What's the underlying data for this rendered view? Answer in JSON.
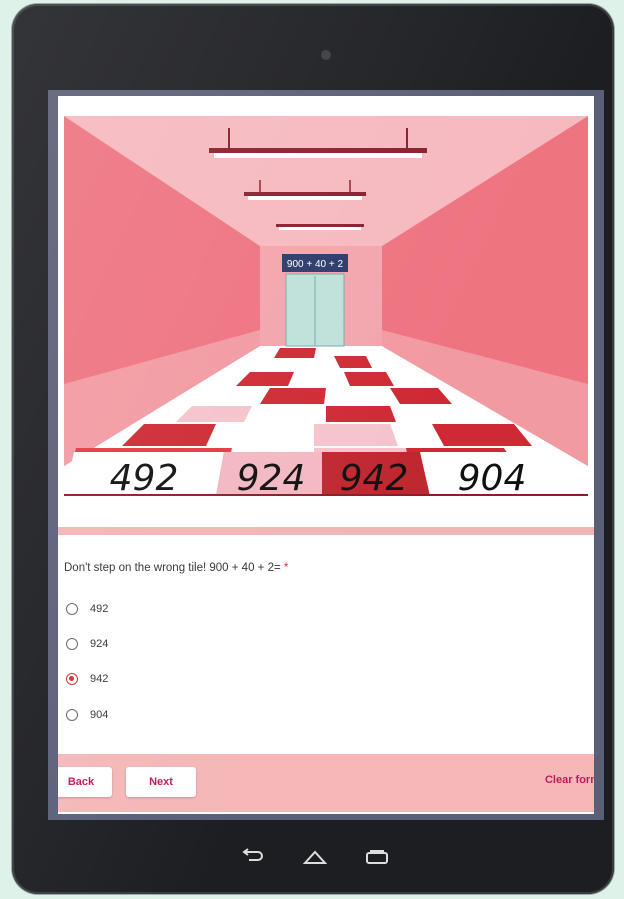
{
  "hero": {
    "elevator_sign": "900 + 40 + 2",
    "tiles": [
      "492",
      "924",
      "942",
      "904"
    ]
  },
  "question": {
    "text": "Don't step on the wrong tile! 900 + 40 + 2=",
    "required_mark": "*"
  },
  "options": [
    "492",
    "924",
    "942",
    "904"
  ],
  "selected_option": "942",
  "nav": {
    "back_label": "Back",
    "next_label": "Next",
    "clear_label": "Clear form"
  },
  "system_nav": {
    "icons": [
      "back-icon",
      "home-icon",
      "recents-icon"
    ]
  },
  "colors": {
    "accent": "#d93025",
    "link": "#c2185b",
    "panel_pink": "#f5b7b8",
    "tablet_frame": "#1d1e22"
  }
}
